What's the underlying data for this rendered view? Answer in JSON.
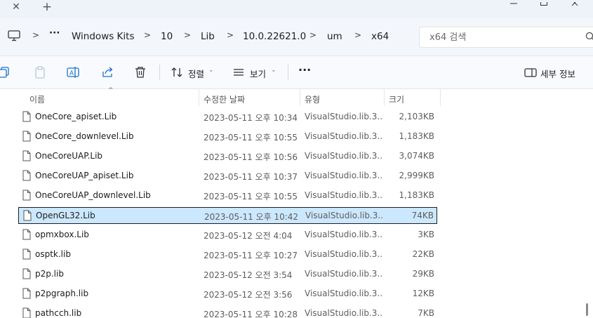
{
  "titlebar": {
    "close_glyph": "✕",
    "add_glyph": "+"
  },
  "address": {
    "more": "···",
    "crumbs": [
      "Windows Kits",
      "10",
      "Lib",
      "10.0.22621.0",
      "um",
      "x64"
    ]
  },
  "search": {
    "placeholder": "x64 검색"
  },
  "toolbar": {
    "sort_label": "정렬",
    "view_label": "보기",
    "more_label": "···",
    "details_label": "세부 정보"
  },
  "columns": {
    "name": "이름",
    "date": "수정한 날짜",
    "type": "유형",
    "size": "크기"
  },
  "files": [
    {
      "name": "OneCore_apiset.Lib",
      "date": "2023-05-11 오후 10:34",
      "type": "VisualStudio.lib.3...",
      "size": "2,103KB",
      "selected": false
    },
    {
      "name": "OneCore_downlevel.Lib",
      "date": "2023-05-11 오후 10:55",
      "type": "VisualStudio.lib.3...",
      "size": "1,183KB",
      "selected": false
    },
    {
      "name": "OneCoreUAP.Lib",
      "date": "2023-05-11 오후 10:56",
      "type": "VisualStudio.lib.3...",
      "size": "3,074KB",
      "selected": false
    },
    {
      "name": "OneCoreUAP_apiset.Lib",
      "date": "2023-05-11 오후 10:37",
      "type": "VisualStudio.lib.3...",
      "size": "2,999KB",
      "selected": false
    },
    {
      "name": "OneCoreUAP_downlevel.Lib",
      "date": "2023-05-11 오후 10:55",
      "type": "VisualStudio.lib.3...",
      "size": "1,183KB",
      "selected": false
    },
    {
      "name": "OpenGL32.Lib",
      "date": "2023-05-11 오후 10:42",
      "type": "VisualStudio.lib.3...",
      "size": "74KB",
      "selected": true
    },
    {
      "name": "opmxbox.Lib",
      "date": "2023-05-12 오전 4:04",
      "type": "VisualStudio.lib.3...",
      "size": "3KB",
      "selected": false
    },
    {
      "name": "osptk.lib",
      "date": "2023-05-11 오후 10:27",
      "type": "VisualStudio.lib.3...",
      "size": "22KB",
      "selected": false
    },
    {
      "name": "p2p.lib",
      "date": "2023-05-12 오전 3:54",
      "type": "VisualStudio.lib.3...",
      "size": "29KB",
      "selected": false
    },
    {
      "name": "p2pgraph.lib",
      "date": "2023-05-12 오전 3:56",
      "type": "VisualStudio.lib.3...",
      "size": "12KB",
      "selected": false
    },
    {
      "name": "pathcch.lib",
      "date": "2023-05-11 오후 10:28",
      "type": "VisualStudio.lib.3...",
      "size": "7KB",
      "selected": false
    }
  ],
  "colors": {
    "selection_bg": "#cce8ff",
    "selection_border": "#1e1e1e",
    "toolbar_bg": "#f9fafd",
    "address_bg": "#f3f6fb",
    "titlebar_bg": "#eef2f9"
  },
  "icons": {
    "tab_close": "close-icon",
    "tab_add": "plus-icon",
    "computer": "monitor-icon",
    "search": "search-icon",
    "copy": "copy-icon",
    "paste": "paste-icon",
    "rename": "rename-icon",
    "share": "share-icon",
    "delete": "trash-icon",
    "sort": "sort-icon",
    "view": "view-list-icon",
    "details": "details-pane-icon",
    "file": "file-icon"
  }
}
